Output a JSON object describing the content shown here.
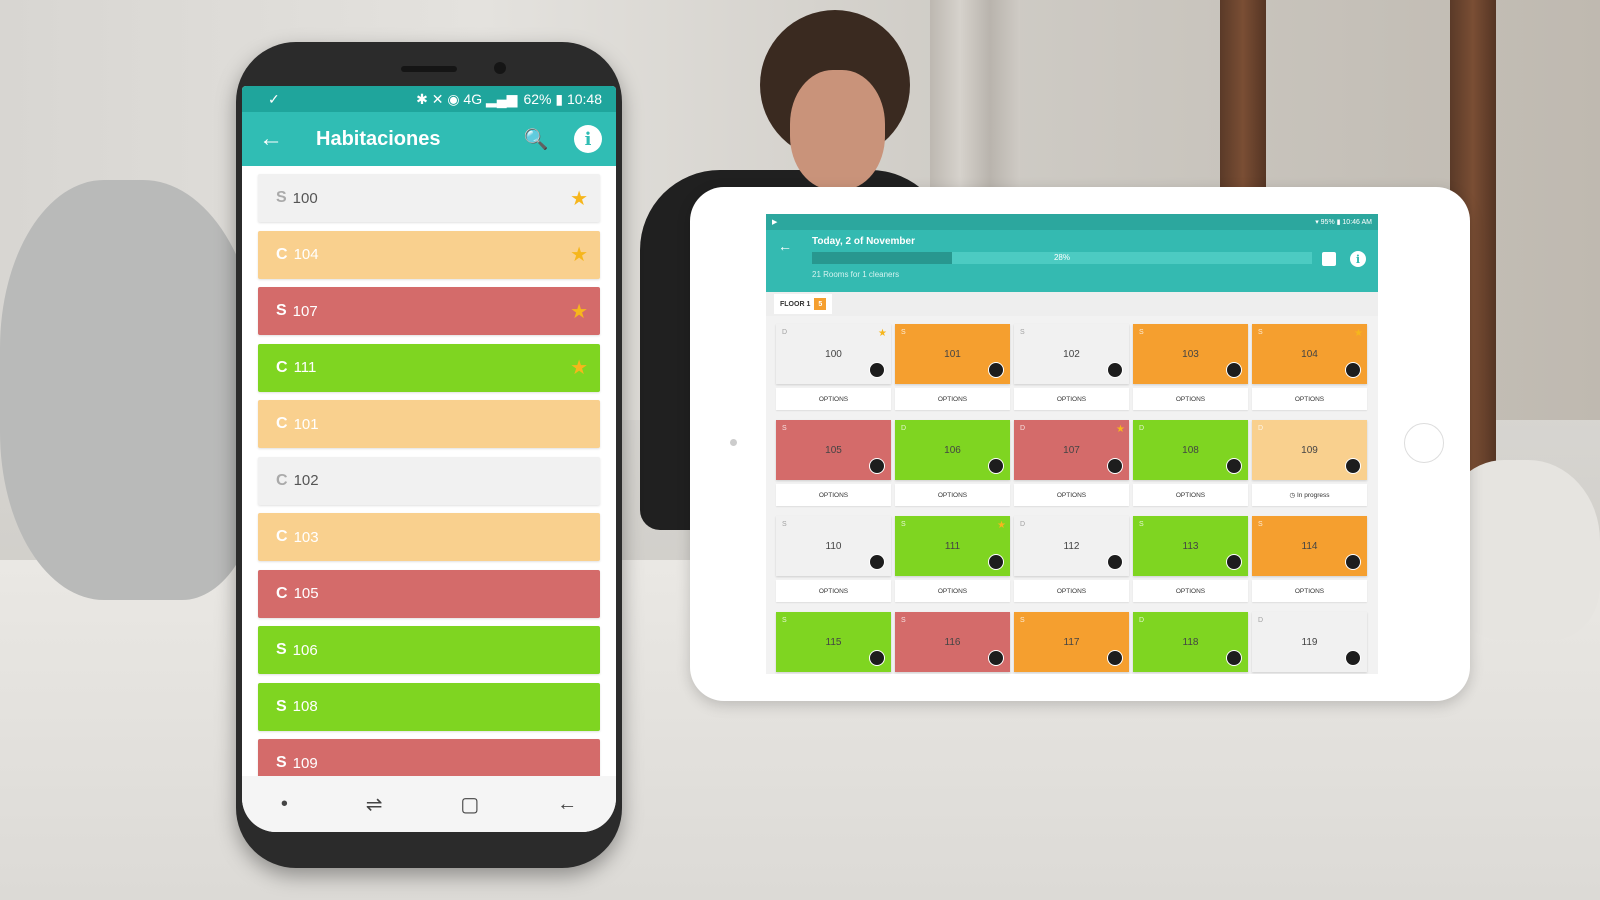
{
  "colors": {
    "white": "#f1f1f1",
    "peach": "#f9d08e",
    "red": "#d46b6a",
    "green": "#7fd521",
    "orange": "#f59f2f",
    "teal": "#30bdb4"
  },
  "phone": {
    "status": {
      "left_icon": "✓",
      "right_text": "62% ▮ 10:48",
      "icons": "✱ ✕ ◉ 4G ▂▄▆"
    },
    "appbar": {
      "back_icon": "←",
      "title": "Habitaciones",
      "search_icon": "🔍",
      "info_icon": "i"
    },
    "rooms": [
      {
        "type": "S",
        "number": "100",
        "color": "white",
        "star": true
      },
      {
        "type": "C",
        "number": "104",
        "color": "peach",
        "star": true
      },
      {
        "type": "S",
        "number": "107",
        "color": "red",
        "star": true
      },
      {
        "type": "C",
        "number": "111",
        "color": "green",
        "star": true
      },
      {
        "type": "C",
        "number": "101",
        "color": "peach",
        "star": false
      },
      {
        "type": "C",
        "number": "102",
        "color": "white",
        "star": false
      },
      {
        "type": "C",
        "number": "103",
        "color": "peach",
        "star": false
      },
      {
        "type": "C",
        "number": "105",
        "color": "red",
        "star": false
      },
      {
        "type": "S",
        "number": "106",
        "color": "green",
        "star": false
      },
      {
        "type": "S",
        "number": "108",
        "color": "green",
        "star": false
      },
      {
        "type": "S",
        "number": "109",
        "color": "red",
        "star": false
      }
    ],
    "nav": {
      "dot": "•",
      "recent": "⇌",
      "home": "▢",
      "back": "←"
    }
  },
  "tablet": {
    "status": {
      "left": "▶",
      "right": "▾ 95% ▮ 10:46 AM"
    },
    "header": {
      "back_icon": "←",
      "date": "Today, 2 of November",
      "progress": 28,
      "progress_label": "28%",
      "subtitle": "21 Rooms for 1 cleaners",
      "info_icon": "i"
    },
    "floor": {
      "label": "FLOOR 1",
      "badge": "5"
    },
    "cards": [
      {
        "num": "100",
        "st": "D",
        "color": "white",
        "star": true,
        "opt": "OPTIONS"
      },
      {
        "num": "101",
        "st": "S",
        "color": "orange",
        "star": false,
        "opt": "OPTIONS"
      },
      {
        "num": "102",
        "st": "S",
        "color": "white",
        "star": false,
        "opt": "OPTIONS"
      },
      {
        "num": "103",
        "st": "S",
        "color": "orange",
        "star": false,
        "opt": "OPTIONS"
      },
      {
        "num": "104",
        "st": "S",
        "color": "orange",
        "star": true,
        "opt": "OPTIONS"
      },
      {
        "num": "105",
        "st": "S",
        "color": "red",
        "star": false,
        "opt": "OPTIONS"
      },
      {
        "num": "106",
        "st": "D",
        "color": "green",
        "star": false,
        "opt": "OPTIONS"
      },
      {
        "num": "107",
        "st": "D",
        "color": "red",
        "star": true,
        "opt": "OPTIONS"
      },
      {
        "num": "108",
        "st": "D",
        "color": "green",
        "star": false,
        "opt": "OPTIONS"
      },
      {
        "num": "109",
        "st": "D",
        "color": "peach",
        "star": false,
        "opt": "◷ In progress"
      },
      {
        "num": "110",
        "st": "S",
        "color": "white",
        "star": false,
        "opt": "OPTIONS"
      },
      {
        "num": "111",
        "st": "S",
        "color": "green",
        "star": true,
        "opt": "OPTIONS"
      },
      {
        "num": "112",
        "st": "D",
        "color": "white",
        "star": false,
        "opt": "OPTIONS"
      },
      {
        "num": "113",
        "st": "S",
        "color": "green",
        "star": false,
        "opt": "OPTIONS"
      },
      {
        "num": "114",
        "st": "S",
        "color": "orange",
        "star": false,
        "opt": "OPTIONS"
      },
      {
        "num": "115",
        "st": "S",
        "color": "green",
        "star": false,
        "opt": ""
      },
      {
        "num": "116",
        "st": "S",
        "color": "red",
        "star": false,
        "opt": ""
      },
      {
        "num": "117",
        "st": "S",
        "color": "orange",
        "star": false,
        "opt": ""
      },
      {
        "num": "118",
        "st": "D",
        "color": "green",
        "star": false,
        "opt": ""
      },
      {
        "num": "119",
        "st": "D",
        "color": "white",
        "star": false,
        "opt": ""
      }
    ]
  }
}
